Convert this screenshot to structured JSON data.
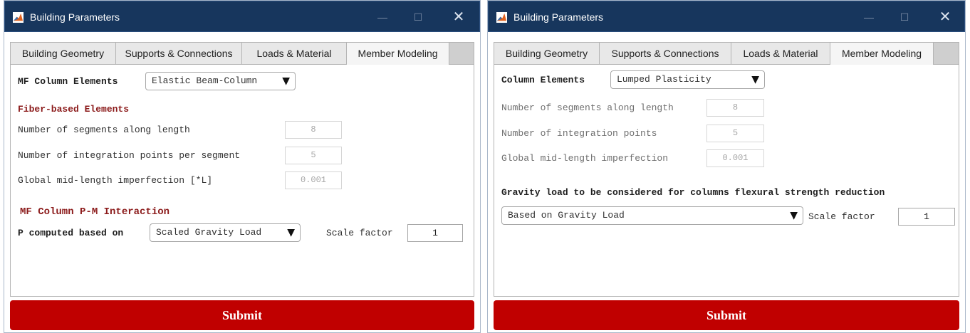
{
  "accent_color": "#c00000",
  "section_color": "#8b1a1a",
  "titlebar_color": "#17365d",
  "windows": [
    {
      "title": "Building Parameters",
      "tabs": [
        "Building Geometry",
        "Supports & Connections",
        "Loads & Material",
        "Member Modeling"
      ],
      "active_tab": "Member Modeling",
      "column_elements_label": "MF Column Elements",
      "column_elements_value": "Elastic Beam-Column",
      "fiber_section_title": "Fiber-based Elements",
      "segments_label": "Number of segments along length",
      "segments_value": "8",
      "integration_label": "Number of integration points per segment",
      "integration_value": "5",
      "imperfection_label": "Global mid-length imperfection [*L]",
      "imperfection_value": "0.001",
      "pm_section_title": "MF Column P-M Interaction",
      "p_computed_label": "P computed based on",
      "p_computed_value": "Scaled Gravity Load",
      "scale_factor_label": "Scale factor",
      "scale_factor_value": "1",
      "submit_label": "Submit"
    },
    {
      "title": "Building Parameters",
      "tabs": [
        "Building Geometry",
        "Supports & Connections",
        "Loads & Material",
        "Member Modeling"
      ],
      "active_tab": "Member Modeling",
      "column_elements_label": "Column Elements",
      "column_elements_value": "Lumped Plasticity",
      "segments_label": "Number of segments along length",
      "segments_value": "8",
      "integration_label": "Number of integration points",
      "integration_value": "5",
      "imperfection_label": "Global mid-length imperfection",
      "imperfection_value": "0.001",
      "gravity_title": "Gravity load to be considered for columns flexural strength reduction",
      "gravity_value": "Based on Gravity Load",
      "scale_factor_label": "Scale factor",
      "scale_factor_value": "1",
      "submit_label": "Submit"
    }
  ],
  "window_controls": {
    "minimize": "—",
    "maximize": "☐",
    "close": "✕"
  },
  "icons": {
    "app_logo": "matlab-logo-icon",
    "dropdown": "▼"
  }
}
